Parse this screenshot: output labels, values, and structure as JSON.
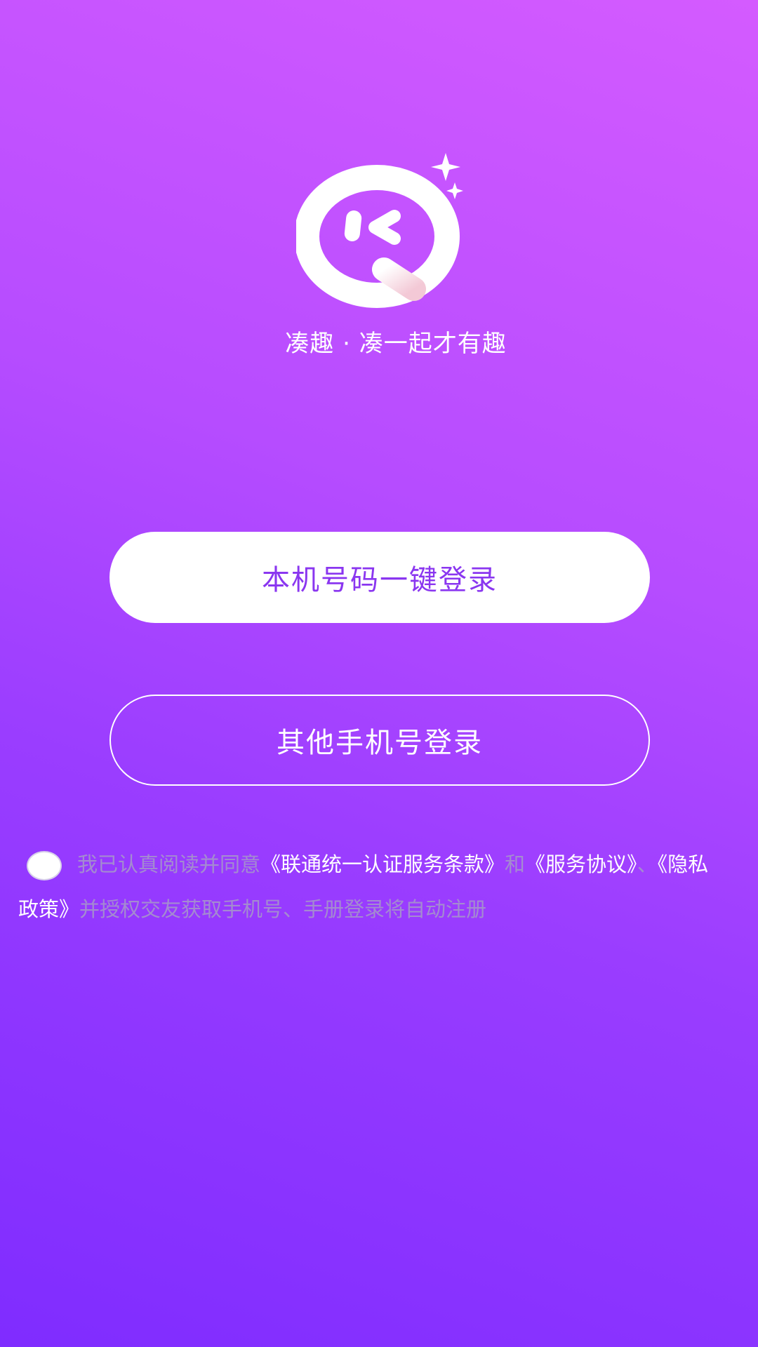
{
  "app": {
    "slogan": "凑趣 · 凑一起才有趣"
  },
  "buttons": {
    "one_click_login": "本机号码一键登录",
    "other_phone_login": "其他手机号登录"
  },
  "agreement": {
    "prefix": "我已认真阅读并同意",
    "link_terms": "《联通统一认证服务条款》",
    "and": "和",
    "link_service": "《服务协议》",
    "sep": "、",
    "link_privacy": "《隐私政策》",
    "suffix": "并授权交友获取手机号、手册登录将自动注册"
  },
  "icons": {
    "logo": "chat-bubble-wink-logo",
    "sparkle": "sparkle-icon",
    "checkbox": "radio-circle"
  },
  "colors": {
    "gradient_top": "#d45bff",
    "gradient_bottom": "#7f2cff",
    "primary_text": "#8a36f0",
    "muted_text": "#a48bd0",
    "white": "#ffffff"
  }
}
